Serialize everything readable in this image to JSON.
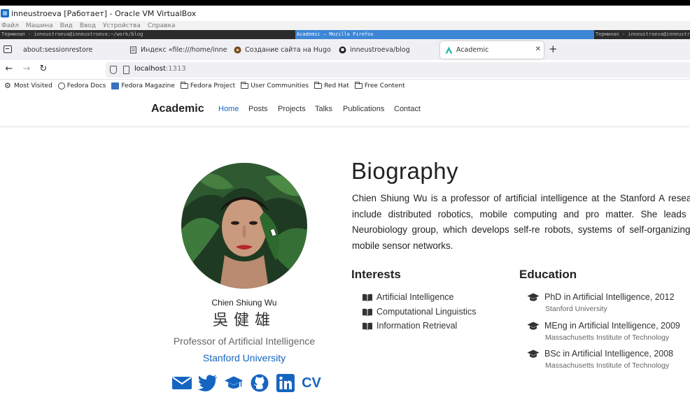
{
  "vm_window": {
    "title": "inneustroeva [Работает] - Oracle VM VirtualBox",
    "menu": [
      "Файл",
      "Машина",
      "Вид",
      "Ввод",
      "Устройства",
      "Справка"
    ]
  },
  "guest_taskbar": [
    "Терминал - inneustroeva@inneustroeva:~/work/blog",
    "Academic — Mozilla Firefox",
    "Терминал - inneustroeva@inneustroeva:~/work/blog"
  ],
  "browser": {
    "tabs": [
      {
        "title": "about:sessionrestore"
      },
      {
        "title": "Индекс «file:///home/inne"
      },
      {
        "title": "Создание сайта на Hugo"
      },
      {
        "title": "inneustroeva/blog"
      },
      {
        "title": "Academic",
        "active": true
      }
    ],
    "url": {
      "host": "localhost",
      "port": ":1313"
    },
    "bookmarks": [
      {
        "label": "Most Visited",
        "icon": "gear-icon"
      },
      {
        "label": "Fedora Docs",
        "icon": "globe-icon"
      },
      {
        "label": "Fedora Magazine",
        "icon": "fedora-magazine-icon"
      },
      {
        "label": "Fedora Project",
        "icon": "folder-icon"
      },
      {
        "label": "User Communities",
        "icon": "folder-icon"
      },
      {
        "label": "Red Hat",
        "icon": "folder-icon"
      },
      {
        "label": "Free Content",
        "icon": "folder-icon"
      }
    ]
  },
  "site": {
    "brand": "Academic",
    "nav": [
      "Home",
      "Posts",
      "Projects",
      "Talks",
      "Publications",
      "Contact"
    ],
    "active_nav": "Home",
    "accent_color": "#1565c0"
  },
  "profile": {
    "name": "Chien Shiung Wu",
    "name_cjk": "吳健雄",
    "role": "Professor of Artificial Intelligence",
    "organization": "Stanford University",
    "socials": [
      "envelope-icon",
      "twitter-icon",
      "graduation-cap-icon",
      "github-icon",
      "linkedin-icon"
    ],
    "cv_label": "CV"
  },
  "biography": {
    "title": "Biography",
    "text": "Chien Shiung Wu is a professor of artificial intelligence at the Stanford A research interests include distributed robotics, mobile computing and pro matter. She leads the Robotic Neurobiology group, which develops self-re robots, systems of self-organizing robots, and mobile sensor networks."
  },
  "interests": {
    "title": "Interests",
    "items": [
      "Artificial Intelligence",
      "Computational Linguistics",
      "Information Retrieval"
    ]
  },
  "education": {
    "title": "Education",
    "items": [
      {
        "degree": "PhD in Artificial Intelligence, 2012",
        "institution": "Stanford University"
      },
      {
        "degree": "MEng in Artificial Intelligence, 2009",
        "institution": "Massachusetts Institute of Technology"
      },
      {
        "degree": "BSc in Artificial Intelligence, 2008",
        "institution": "Massachusetts Institute of Technology"
      }
    ]
  }
}
